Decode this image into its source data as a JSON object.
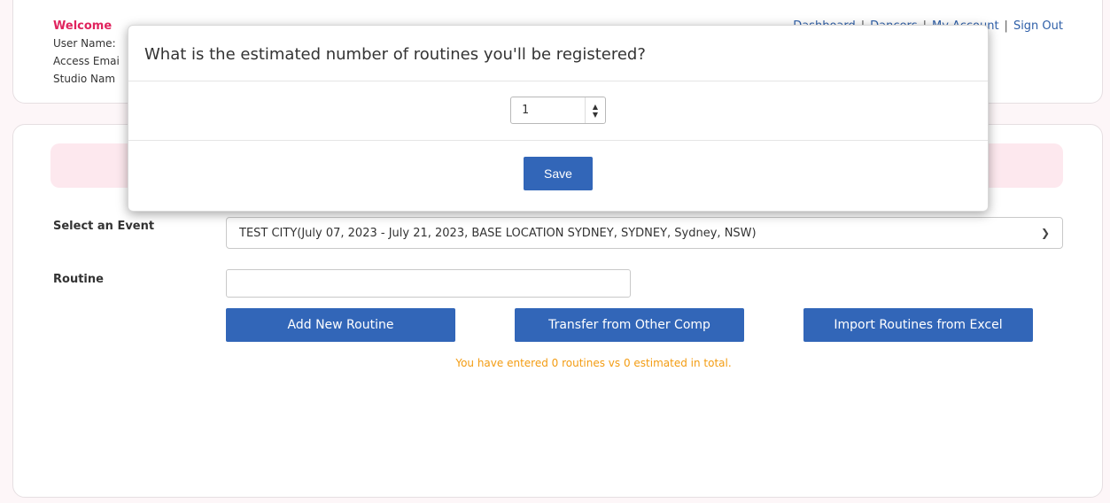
{
  "header": {
    "welcome": "Welcome",
    "user_name_label": "User Name:",
    "access_email_label": "Access Emai",
    "studio_name_label": "Studio Nam",
    "nav": [
      "Dashboard",
      "Dancers",
      "My Account",
      "Sign Out"
    ]
  },
  "form": {
    "event_label": "Select an Event",
    "event_value": "TEST CITY(July 07, 2023 - July 21, 2023, BASE LOCATION SYDNEY, SYDNEY, Sydney, NSW)",
    "routine_label": "Routine",
    "routine_value": "",
    "buttons": {
      "add": "Add New Routine",
      "transfer": "Transfer from Other Comp",
      "import": "Import Routines from Excel"
    },
    "note": "You have entered 0 routines vs 0 estimated in total."
  },
  "modal": {
    "title": "What is the estimated number of routines you'll be registered?",
    "spinner_value": "1",
    "save_label": "Save"
  },
  "colors": {
    "accent": "#3266b8",
    "welcome": "#e0245e",
    "note": "#f39c12",
    "pink_bar": "#fde8ee"
  }
}
